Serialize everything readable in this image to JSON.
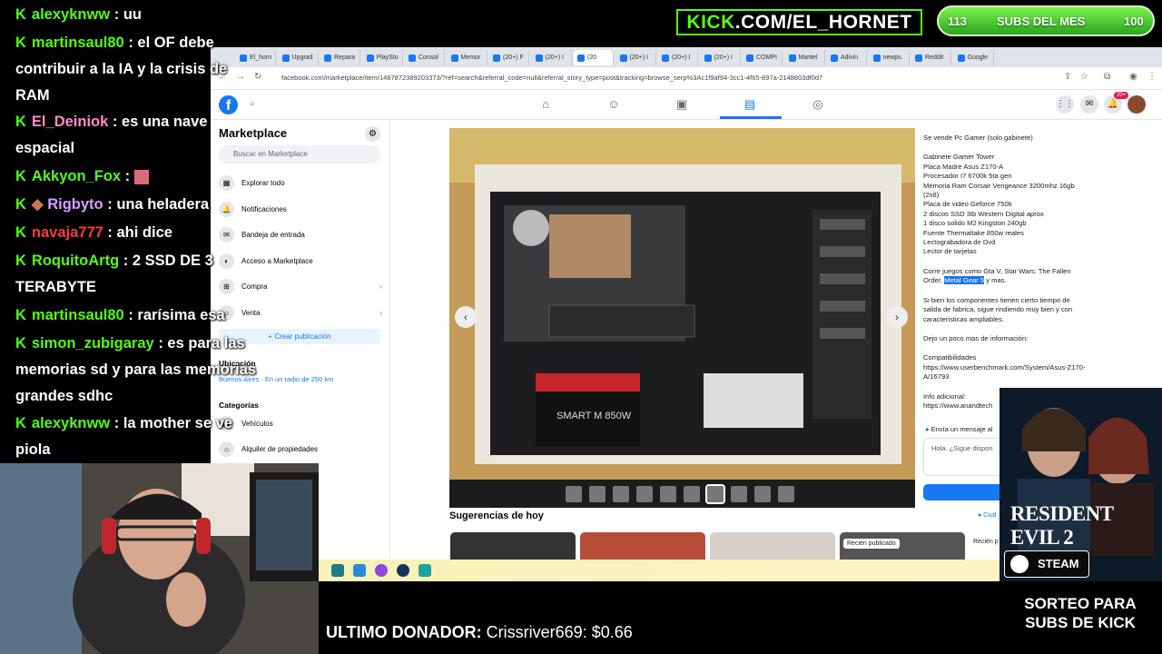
{
  "overlay": {
    "kick_url": "KICK.COM/EL_HORNET",
    "kick_url_prefix": "KICK",
    "kick_url_rest": ".COM/EL_HORNET",
    "subs_current": "113",
    "subs_label": "SUBS DEL MES",
    "subs_goal": "100",
    "last_donor_label": "ULTIMO DONADOR:",
    "last_donor_value": "Crissriver669: $0.66",
    "promo_game": "RESIDENT EVIL 2",
    "promo_platform": "STEAM",
    "promo_text": "SORTEO PARA SUBS DE KICK",
    "accent": "#53fc18"
  },
  "chat": [
    {
      "user": "alexyknww",
      "color": "#53fc18",
      "message": ": uu"
    },
    {
      "user": "martinsaul80",
      "color": "#53fc18",
      "message": ": el OF debe contribuir a la IA y la crisis de RAM"
    },
    {
      "user": "El_Deiniok",
      "color": "#ff8cc6",
      "message": ": es una nave espacial"
    },
    {
      "user": "Akkyon_Fox",
      "color": "#53fc18",
      "message": ":"
    },
    {
      "user": "Rigbyto",
      "color": "#d79bff",
      "message": ": una heladera"
    },
    {
      "user": "navaja777",
      "color": "#ff3b3b",
      "message": ": ahi dice"
    },
    {
      "user": "RoquitoArtg",
      "color": "#53fc18",
      "message": ": 2 SSD DE 3 TERABYTE"
    },
    {
      "user": "martinsaul80",
      "color": "#53fc18",
      "message": ": rarísima esa"
    },
    {
      "user": "simon_zubigaray",
      "color": "#53fc18",
      "message": ": es para las memorias sd y para las memorias grandes sdhc"
    },
    {
      "user": "alexyknww",
      "color": "#53fc18",
      "message": ": la mother se ve piola"
    }
  ],
  "browser": {
    "tabs": [
      "El_horn",
      "Upgrad",
      "Repara",
      "PlaySto",
      "Consol",
      "Memor",
      "(20+) F",
      "(20+) I",
      "(20",
      "(20+) I",
      "(20+) I",
      "(20+) I",
      "COMPI",
      "Mantel",
      "Adivin",
      "newps",
      "Reddit",
      "Google"
    ],
    "url": "facebook.com/marketplace/item/1487872389203373/?ref=search&referral_code=null&referral_story_type=post&tracking=browse_serp%3Ac1f9af94-3cc1-4f65-897a-2148803df0d7",
    "notif_badge": "20+"
  },
  "sidebar": {
    "title": "Marketplace",
    "search_placeholder": "Buscar en Marketplace",
    "items": [
      {
        "label": "Explorar todo"
      },
      {
        "label": "Notificaciones"
      },
      {
        "label": "Bandeja de entrada"
      },
      {
        "label": "Acceso a Marketplace"
      },
      {
        "label": "Compra"
      },
      {
        "label": "Venta"
      }
    ],
    "create_label": "+ Crear publicación",
    "location_title": "Ubicación",
    "location_value": "Buenos Aires · En un radio de 250 km",
    "categories_title": "Categorías",
    "categories": [
      {
        "label": "Vehículos"
      },
      {
        "label": "Alquiler de propiedades"
      }
    ]
  },
  "listing": {
    "desc_title": "Se vende Pc Gamer (solo gabinete)",
    "specs": "Gabinete Gamer Tower\nPlaca Madre Asus Z170-A\nProcesador I7 6700k 5ta gen\nMemoria Ram Corsair Vengeance 3200mhz 16gb (2x8)\nPlaca de video Geforce 750ti\n2 discos SSD 3tb Western Digital aprox\n1 disco solido M2 Kingston 240gb\nFuente Thermaltake 850w reales\nLectograbadora de Dvd\nLector de tarjetas",
    "games_prefix": "Corre juegos como Gta V, Star Wars: The Fallen Order,",
    "games_highlight": "Metal Gear 5",
    "games_suffix": "y mas.",
    "paragraph": "Si bien los componentes tienen cierto tiempo de salida de fabrica, sigue rindiendo muy bien y con caracteristicas ampliables.",
    "more_info": "Dejo un poco mas de información:",
    "compat_label": "Compatibilidades",
    "compat_link": "https://www.userbenchmark.com/System/Asus-Z170-A/16793",
    "extra_label": "Info adicional:",
    "extra_link": "https://www.anandtech",
    "send_label": "Envía un mensaje al",
    "message_placeholder": "Hola. ¿Sigue dispon",
    "psu_label": "SMART M 850W",
    "suggestions_title": "Sugerencias de hoy",
    "new_badge": "Recién publicado",
    "new_badge2": "Recién p"
  }
}
